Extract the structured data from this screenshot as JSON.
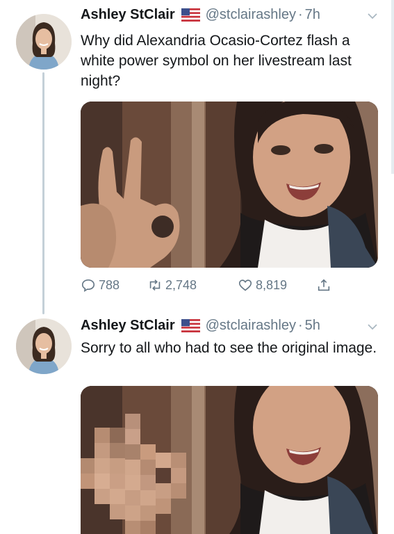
{
  "tweets": [
    {
      "author_name": "Ashley StClair",
      "flag_icon": "us-flag-icon",
      "handle": "@stclairashley",
      "separator": "·",
      "time": "7h",
      "text": "Why did Alexandria Ocasio-Cortez flash a white power symbol on her livestream last night?",
      "actions": {
        "replies": "788",
        "retweets": "2,748",
        "likes": "8,819"
      }
    },
    {
      "author_name": "Ashley StClair",
      "flag_icon": "us-flag-icon",
      "handle": "@stclairashley",
      "separator": "·",
      "time": "5h",
      "text": "Sorry to all who had to see the original image."
    }
  ],
  "colors": {
    "text": "#14171a",
    "secondary": "#657786",
    "thread_line": "#c4d0d8"
  }
}
